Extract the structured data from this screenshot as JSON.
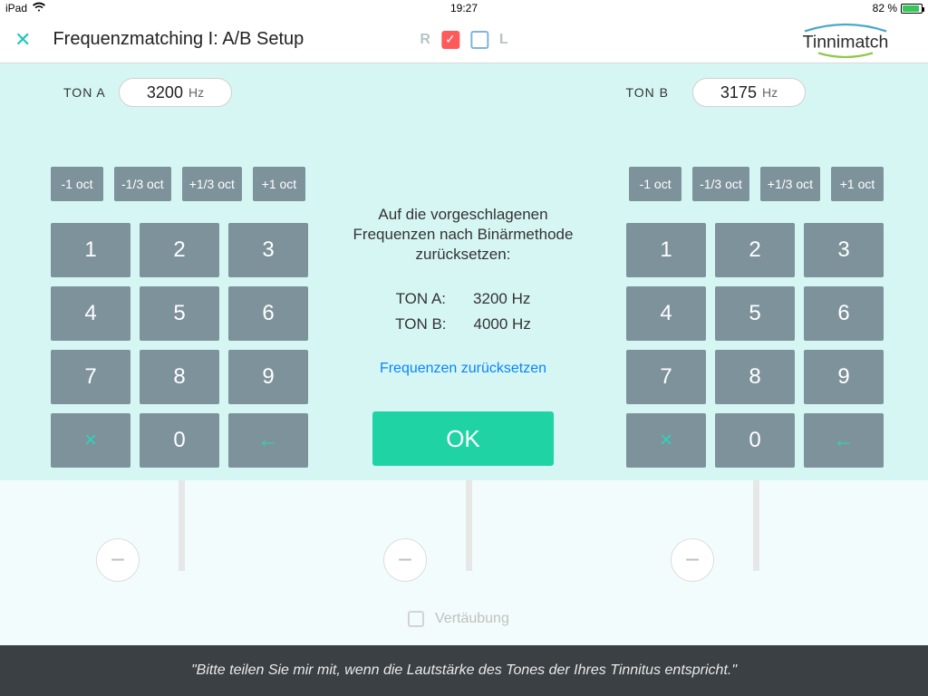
{
  "statusbar": {
    "device": "iPad",
    "time": "19:27",
    "battery_pct": "82 %"
  },
  "header": {
    "title": "Frequenzmatching I: A/B Setup",
    "side_r": "R",
    "side_l": "L"
  },
  "logo": {
    "text": "Tinnimatch"
  },
  "tone": {
    "a_label": "TON A",
    "b_label": "TON B",
    "a_value": "3200",
    "b_value": "3175",
    "unit": "Hz"
  },
  "oct_buttons": [
    "-1 oct",
    "-1/3 oct",
    "+1/3 oct",
    "+1 oct"
  ],
  "keypad": {
    "keys": [
      "1",
      "2",
      "3",
      "4",
      "5",
      "6",
      "7",
      "8",
      "9",
      "×",
      "0",
      "←"
    ]
  },
  "mid": {
    "msg": "Auf die vorgeschlagenen Frequenzen nach Binärmethode zurücksetzen:",
    "ton_a_k": "TON A:",
    "ton_a_v": "3200 Hz",
    "ton_b_k": "TON B:",
    "ton_b_v": "4000 Hz",
    "reset_link": "Frequenzen zurücksetzen",
    "ok": "OK"
  },
  "lower": {
    "vertaubung": "Vertäubung"
  },
  "footer": {
    "quote": "\"Bitte teilen Sie mir mit, wenn die Lautstärke des Tones der Ihres Tinnitus entspricht.\""
  }
}
